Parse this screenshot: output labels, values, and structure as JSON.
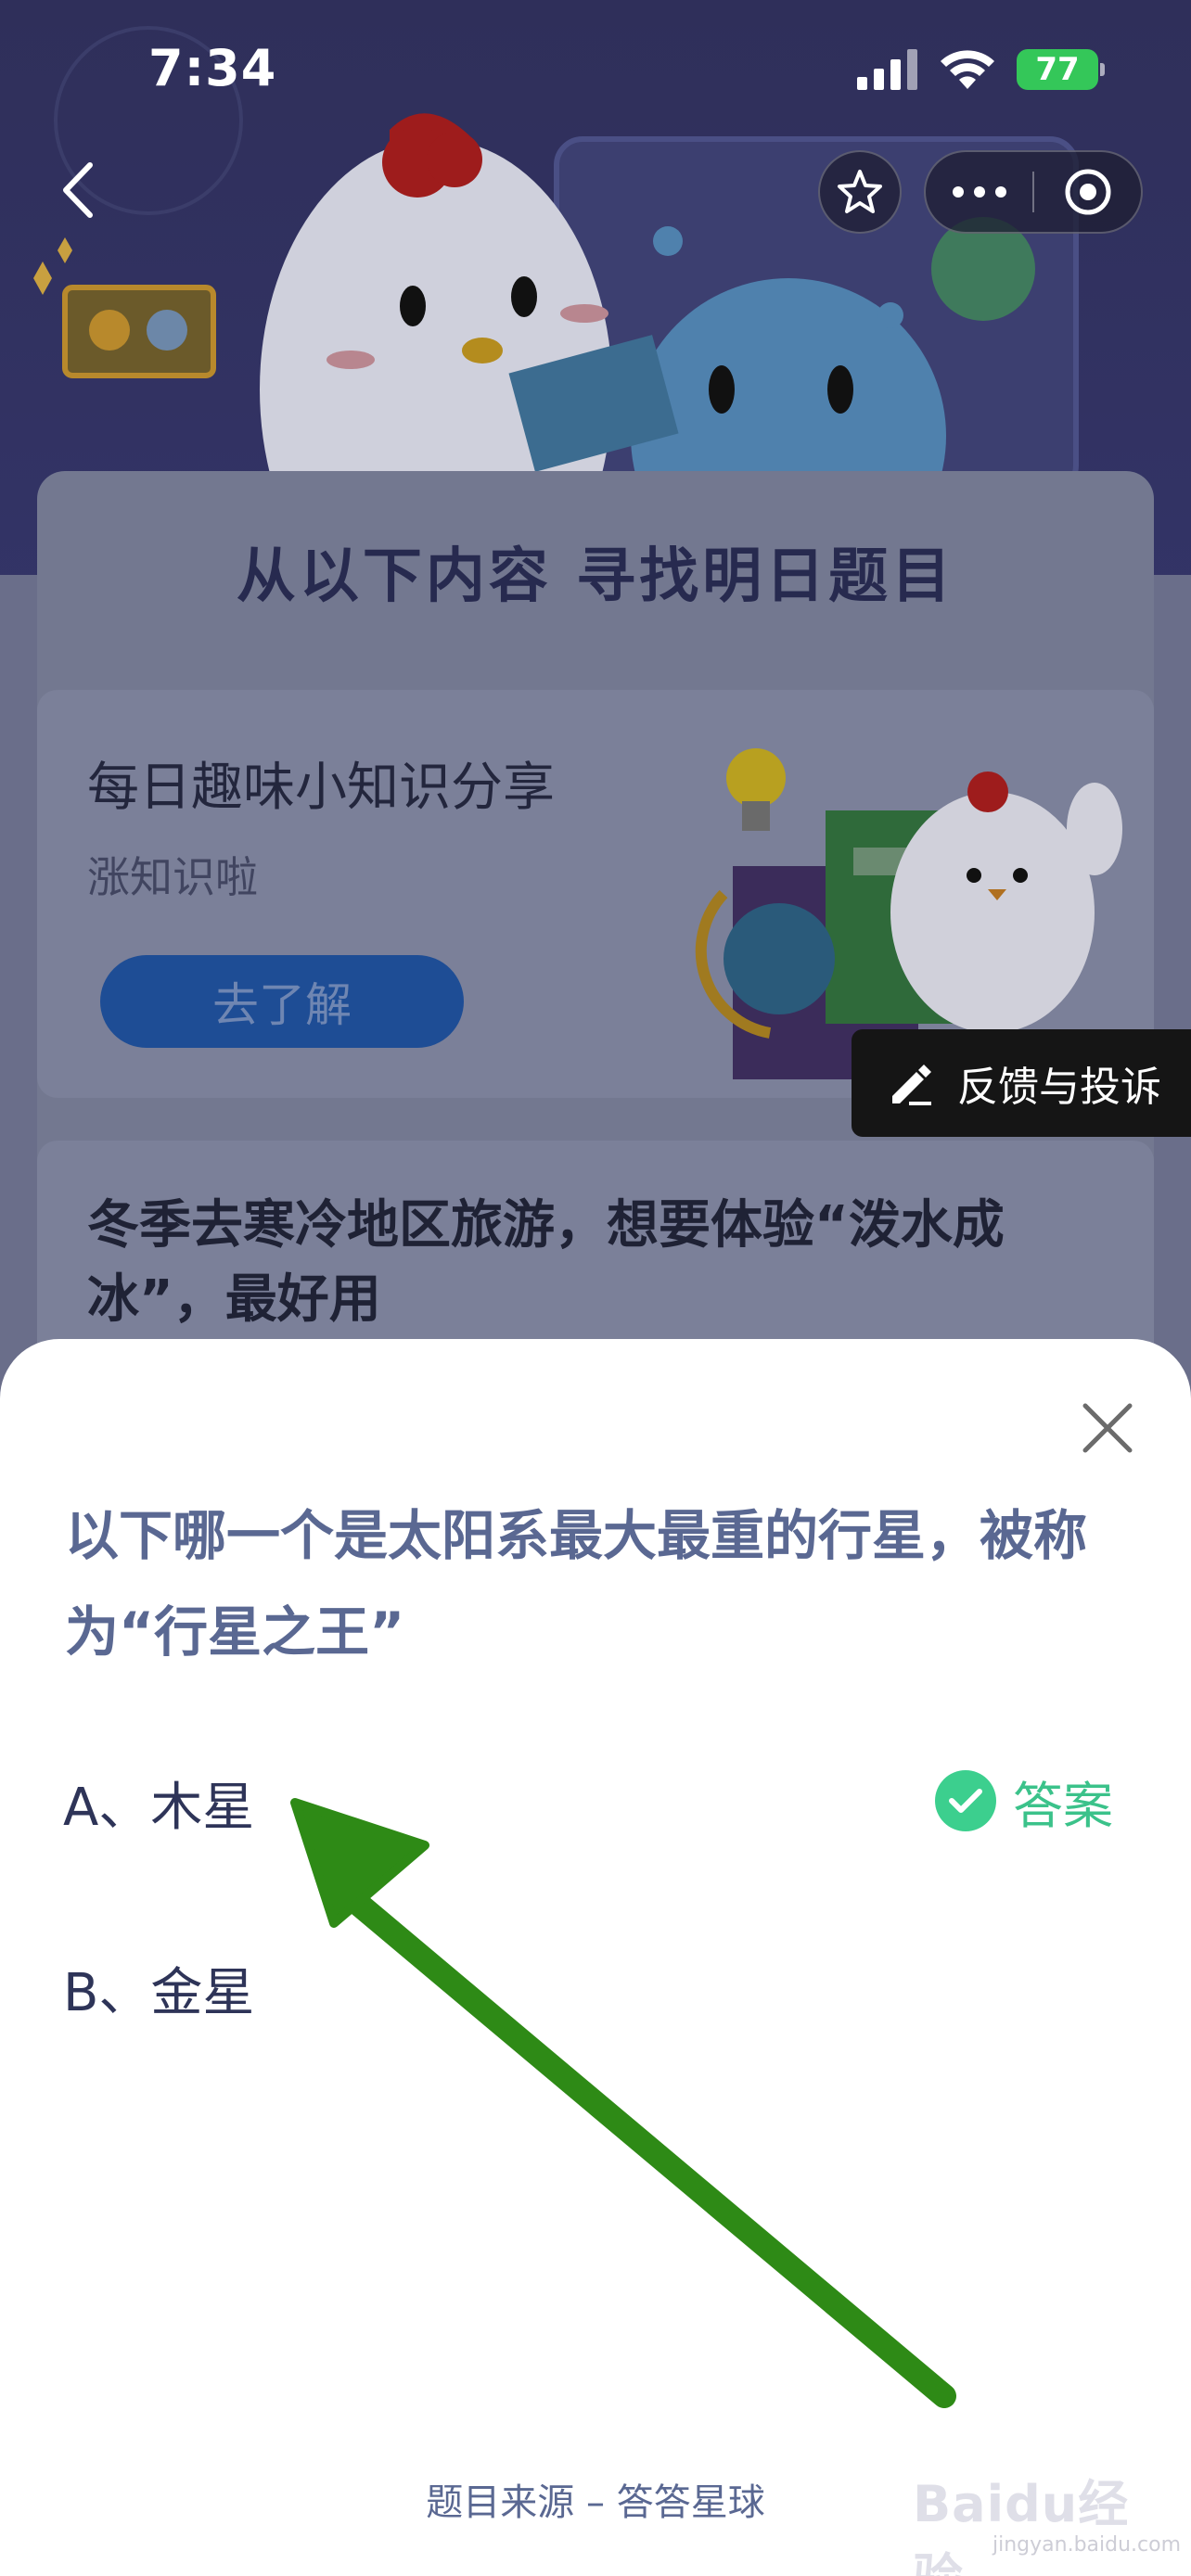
{
  "status_bar": {
    "time": "7:34",
    "battery": "77"
  },
  "nav": {
    "back_icon": "chevron-left-icon",
    "star_icon": "star-icon",
    "more_icon": "more-dots-icon",
    "target_icon": "target-icon"
  },
  "section": {
    "title": "从以下内容  寻找明日题目"
  },
  "promo": {
    "title": "每日趣味小知识分享",
    "subtitle": "涨知识啦",
    "button": "去了解"
  },
  "feedback": {
    "label": "反馈与投诉"
  },
  "question_card": {
    "text": "冬季去寒冷地区旅游，想要体验“泼水成冰”，最好用"
  },
  "sheet": {
    "question": "以下哪一个是太阳系最大最重的行星，被称为“行星之王”",
    "options": [
      {
        "label": "A、木星",
        "is_answer": true
      },
      {
        "label": "B、金星",
        "is_answer": false
      }
    ],
    "answer_label": "答案",
    "source": "题目来源 – 答答星球"
  },
  "watermark": {
    "main": "Baidu经验",
    "sub": "jingyan.baidu.com"
  },
  "colors": {
    "accent_green": "#3ccf8e",
    "question_blue": "#5a6892",
    "arrow_green": "#2e8a16",
    "battery_green": "#34c759"
  }
}
